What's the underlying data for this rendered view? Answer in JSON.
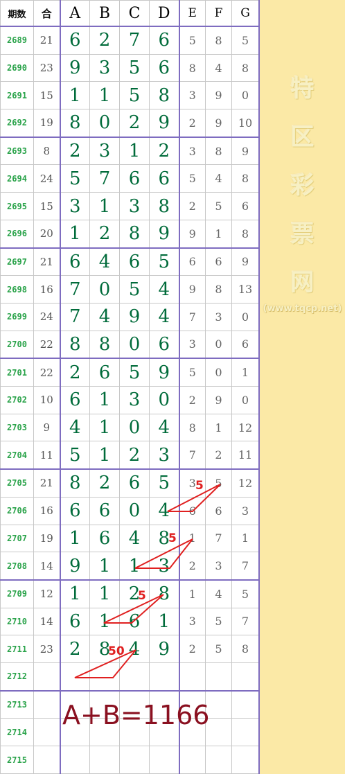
{
  "header": {
    "id": "期数",
    "sum": "合",
    "cols": [
      "A",
      "B",
      "C",
      "D",
      "E",
      "F",
      "G"
    ]
  },
  "rows": [
    {
      "id": "2689",
      "sum": "21",
      "main": [
        "6",
        "2",
        "7",
        "6"
      ],
      "sub": [
        "5",
        "8",
        "5"
      ]
    },
    {
      "id": "2690",
      "sum": "23",
      "main": [
        "9",
        "3",
        "5",
        "6"
      ],
      "sub": [
        "8",
        "4",
        "8"
      ]
    },
    {
      "id": "2691",
      "sum": "15",
      "main": [
        "1",
        "1",
        "5",
        "8"
      ],
      "sub": [
        "3",
        "9",
        "0"
      ]
    },
    {
      "id": "2692",
      "sum": "19",
      "main": [
        "8",
        "0",
        "2",
        "9"
      ],
      "sub": [
        "2",
        "9",
        "10"
      ]
    },
    {
      "id": "2693",
      "sum": "8",
      "main": [
        "2",
        "3",
        "1",
        "2"
      ],
      "sub": [
        "3",
        "8",
        "9"
      ]
    },
    {
      "id": "2694",
      "sum": "24",
      "main": [
        "5",
        "7",
        "6",
        "6"
      ],
      "sub": [
        "5",
        "4",
        "8"
      ]
    },
    {
      "id": "2695",
      "sum": "15",
      "main": [
        "3",
        "1",
        "3",
        "8"
      ],
      "sub": [
        "2",
        "5",
        "6"
      ]
    },
    {
      "id": "2696",
      "sum": "20",
      "main": [
        "1",
        "2",
        "8",
        "9"
      ],
      "sub": [
        "9",
        "1",
        "8"
      ]
    },
    {
      "id": "2697",
      "sum": "21",
      "main": [
        "6",
        "4",
        "6",
        "5"
      ],
      "sub": [
        "6",
        "6",
        "9"
      ]
    },
    {
      "id": "2698",
      "sum": "16",
      "main": [
        "7",
        "0",
        "5",
        "4"
      ],
      "sub": [
        "9",
        "8",
        "13"
      ]
    },
    {
      "id": "2699",
      "sum": "24",
      "main": [
        "7",
        "4",
        "9",
        "4"
      ],
      "sub": [
        "7",
        "3",
        "0"
      ]
    },
    {
      "id": "2700",
      "sum": "22",
      "main": [
        "8",
        "8",
        "0",
        "6"
      ],
      "sub": [
        "3",
        "0",
        "6"
      ]
    },
    {
      "id": "2701",
      "sum": "22",
      "main": [
        "2",
        "6",
        "5",
        "9"
      ],
      "sub": [
        "5",
        "0",
        "1"
      ]
    },
    {
      "id": "2702",
      "sum": "10",
      "main": [
        "6",
        "1",
        "3",
        "0"
      ],
      "sub": [
        "2",
        "9",
        "0"
      ]
    },
    {
      "id": "2703",
      "sum": "9",
      "main": [
        "4",
        "1",
        "0",
        "4"
      ],
      "sub": [
        "8",
        "1",
        "12"
      ]
    },
    {
      "id": "2704",
      "sum": "11",
      "main": [
        "5",
        "1",
        "2",
        "3"
      ],
      "sub": [
        "7",
        "2",
        "11"
      ]
    },
    {
      "id": "2705",
      "sum": "21",
      "main": [
        "8",
        "2",
        "6",
        "5"
      ],
      "sub": [
        "3",
        "5",
        "12"
      ]
    },
    {
      "id": "2706",
      "sum": "16",
      "main": [
        "6",
        "6",
        "0",
        "4"
      ],
      "sub": [
        "6",
        "6",
        "3"
      ]
    },
    {
      "id": "2707",
      "sum": "19",
      "main": [
        "1",
        "6",
        "4",
        "8"
      ],
      "sub": [
        "1",
        "7",
        "1"
      ]
    },
    {
      "id": "2708",
      "sum": "14",
      "main": [
        "9",
        "1",
        "1",
        "3"
      ],
      "sub": [
        "2",
        "3",
        "7"
      ]
    },
    {
      "id": "2709",
      "sum": "12",
      "main": [
        "1",
        "1",
        "2",
        "8"
      ],
      "sub": [
        "1",
        "4",
        "5"
      ]
    },
    {
      "id": "2710",
      "sum": "14",
      "main": [
        "6",
        "1",
        "6",
        "1"
      ],
      "sub": [
        "3",
        "5",
        "7"
      ]
    },
    {
      "id": "2711",
      "sum": "23",
      "main": [
        "2",
        "8",
        "4",
        "9"
      ],
      "sub": [
        "2",
        "5",
        "8"
      ]
    },
    {
      "id": "2712",
      "sum": "",
      "main": [
        "",
        "",
        "",
        ""
      ],
      "sub": [
        "",
        "",
        ""
      ]
    },
    {
      "id": "2713",
      "sum": "",
      "main": [
        "",
        "",
        "",
        ""
      ],
      "sub": [
        "",
        "",
        ""
      ]
    },
    {
      "id": "2714",
      "sum": "",
      "main": [
        "",
        "",
        "",
        ""
      ],
      "sub": [
        "",
        "",
        ""
      ]
    },
    {
      "id": "2715",
      "sum": "",
      "main": [
        "",
        "",
        "",
        ""
      ],
      "sub": [
        "",
        "",
        ""
      ]
    }
  ],
  "annotations": [
    "5",
    "5",
    "5",
    "50"
  ],
  "formula": "A+B=1166",
  "watermark": {
    "chars": [
      "特",
      "区",
      "彩",
      "票",
      "网"
    ],
    "url": "(www.tqcp.net)"
  },
  "colors": {
    "grid_line": "#7e6cc0",
    "main_digit": "#006b3a",
    "id_text": "#2aa34a",
    "annotation": "#e02020",
    "formula": "#8a1020",
    "side_bg": "#fbe9a6"
  }
}
